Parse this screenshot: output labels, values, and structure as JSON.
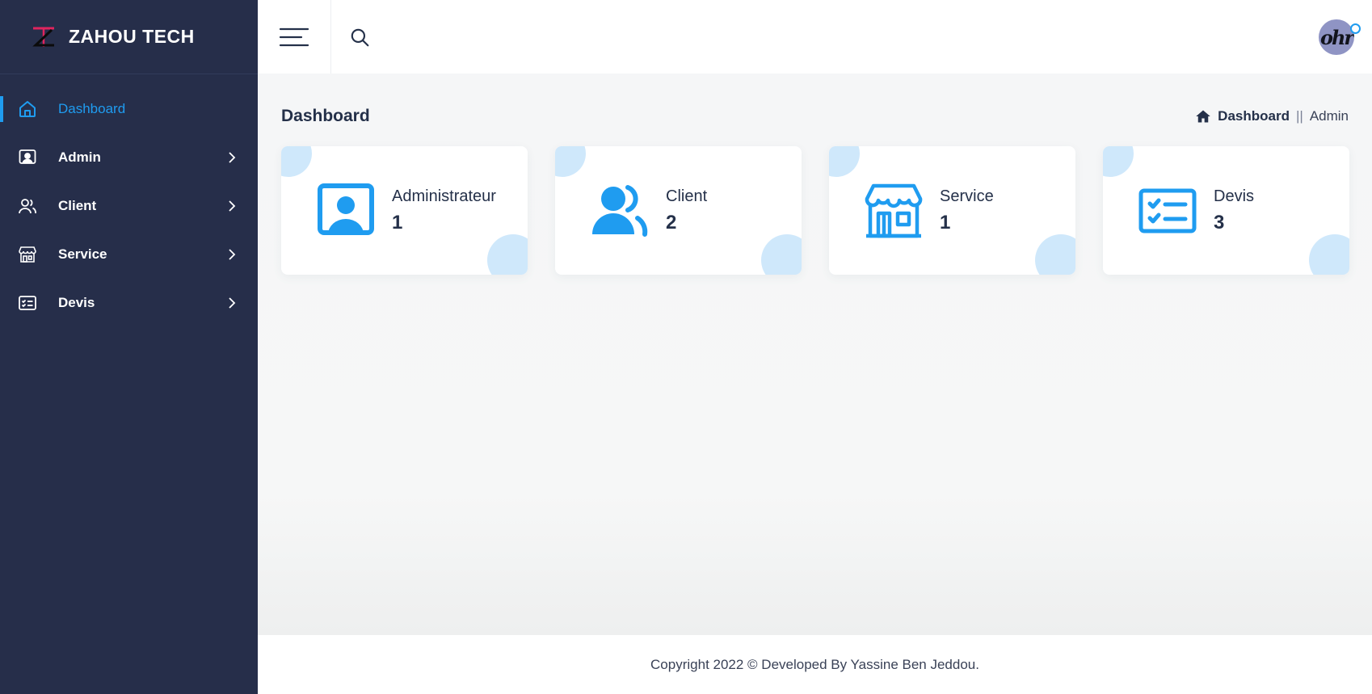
{
  "brand": {
    "name": "ZAHOU TECH",
    "logo_icon": "zt-logo-icon"
  },
  "colors": {
    "sidebar_bg": "#262e4a",
    "accent": "#1f9cf0",
    "blob": "#cfe8fb"
  },
  "sidebar": {
    "items": [
      {
        "label": "Dashboard",
        "icon": "home-icon",
        "active": true
      },
      {
        "label": "Admin",
        "icon": "admin-icon",
        "active": false
      },
      {
        "label": "Client",
        "icon": "users-icon",
        "active": false
      },
      {
        "label": "Service",
        "icon": "store-icon",
        "active": false
      },
      {
        "label": "Devis",
        "icon": "checklist-icon",
        "active": false
      }
    ]
  },
  "header": {
    "menu_icon": "hamburger-icon",
    "search_icon": "search-icon",
    "avatar_text": "ohr"
  },
  "page": {
    "title": "Dashboard",
    "breadcrumb": {
      "main": "Dashboard",
      "separator": "||",
      "current": "Admin"
    }
  },
  "cards": [
    {
      "label": "Administrateur",
      "value": "1",
      "icon": "admin-icon"
    },
    {
      "label": "Client",
      "value": "2",
      "icon": "users-icon"
    },
    {
      "label": "Service",
      "value": "1",
      "icon": "store-icon"
    },
    {
      "label": "Devis",
      "value": "3",
      "icon": "checklist-icon"
    }
  ],
  "footer": {
    "text": "Copyright 2022 © Developed By Yassine Ben Jeddou."
  }
}
